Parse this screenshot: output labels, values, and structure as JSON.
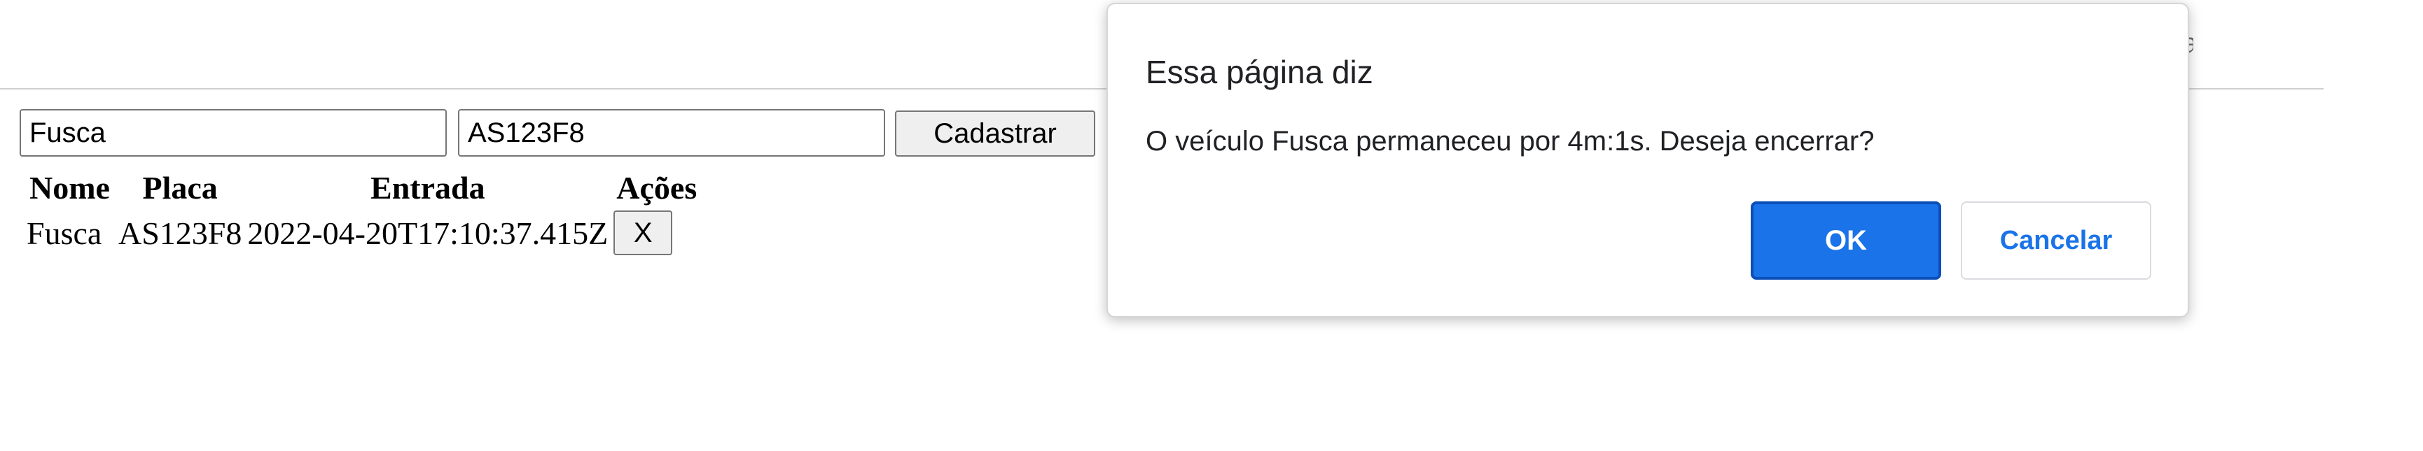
{
  "form": {
    "name_value": "Fusca",
    "plate_value": "AS123F8",
    "submit_label": "Cadastrar"
  },
  "table": {
    "headers": [
      "Nome",
      "Placa",
      "Entrada",
      "Ações"
    ],
    "rows": [
      {
        "nome": "Fusca",
        "placa": "AS123F8",
        "entrada": "2022-04-20T17:10:37.415Z",
        "remove_label": "X"
      }
    ]
  },
  "dialog": {
    "title": "Essa página diz",
    "message": "O veículo Fusca permaneceu por 4m:1s. Deseja encerrar?",
    "ok_label": "OK",
    "cancel_label": "Cancelar"
  },
  "colors": {
    "ok_button": "#1a73e8",
    "cancel_text": "#1a73e8"
  }
}
